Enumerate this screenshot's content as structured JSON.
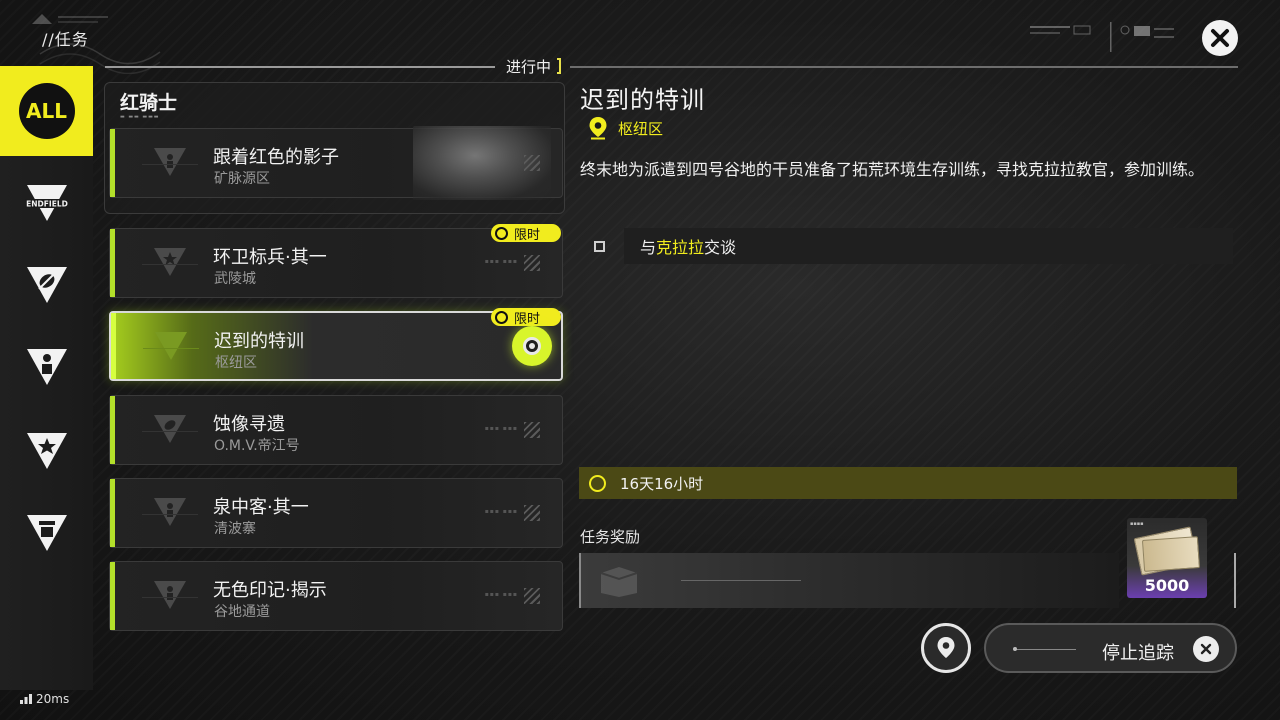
{
  "header": {
    "title": "//任务"
  },
  "status_tag": "进行中",
  "sidebar": {
    "items": [
      {
        "label": "ALL",
        "icon": "all-icon",
        "active": true
      },
      {
        "label": "ENDFIELD",
        "icon": "endfield-icon"
      },
      {
        "label": "",
        "icon": "leaf-triangle-icon"
      },
      {
        "label": "",
        "icon": "person-triangle-icon"
      },
      {
        "label": "",
        "icon": "star-triangle-icon"
      },
      {
        "label": "",
        "icon": "bucket-triangle-icon"
      }
    ]
  },
  "ping": "20ms",
  "quest_group": {
    "title": "红骑士",
    "quests": [
      {
        "name": "跟着红色的影子",
        "location": "矿脉源区"
      }
    ]
  },
  "quests": [
    {
      "name": "环卫标兵·其一",
      "location": "武陵城",
      "badge": "限时"
    },
    {
      "name": "迟到的特训",
      "location": "枢纽区",
      "badge": "限时",
      "selected": true
    },
    {
      "name": "蚀像寻遗",
      "location": "O.M.V.帝江号"
    },
    {
      "name": "泉中客·其一",
      "location": "清波寨"
    },
    {
      "name": "无色印记·揭示",
      "location": "谷地通道"
    }
  ],
  "detail": {
    "title": "迟到的特训",
    "location": "枢纽区",
    "description": "终末地为派遣到四号谷地的干员准备了拓荒环境生存训练，寻找克拉拉教官，参加训练。",
    "objective": {
      "prefix": "与",
      "highlight": "克拉拉",
      "suffix": "交谈"
    },
    "timer": "16天16小时",
    "reward_label": "任务奖励",
    "reward_count": "5000"
  },
  "actions": {
    "stop_tracking": "停止追踪"
  },
  "colors": {
    "accent_yellow": "#f1ec1e",
    "accent_green": "#b3e02a"
  }
}
